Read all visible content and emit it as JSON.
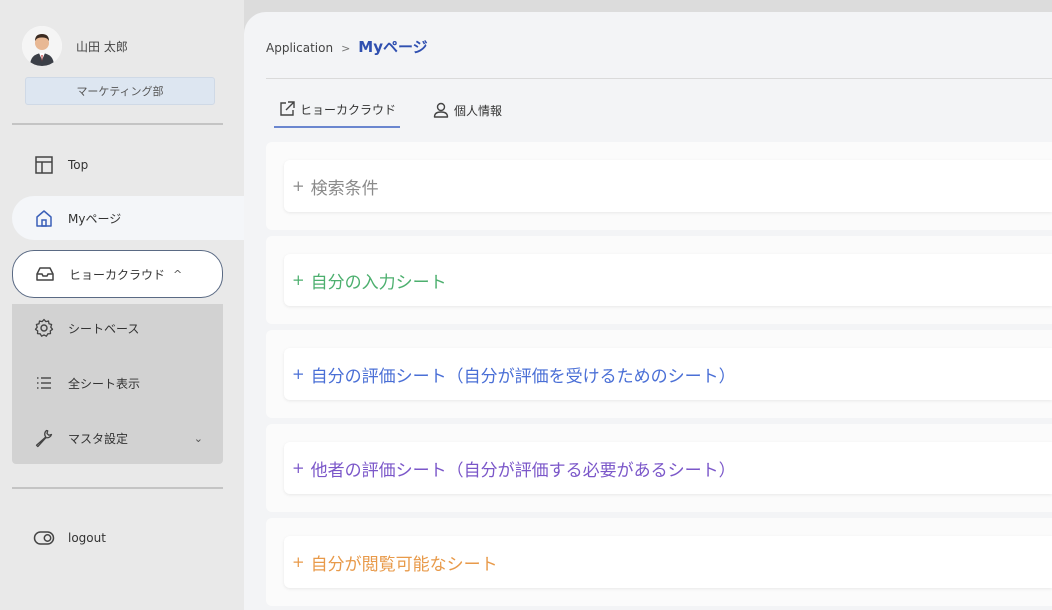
{
  "user": {
    "name": "山田 太郎",
    "department": "マーケティング部"
  },
  "sidebar": {
    "items": [
      {
        "label": "Top",
        "icon": "layout-icon"
      },
      {
        "label": "Myページ",
        "icon": "home-icon"
      },
      {
        "label": "ヒョーカクラウド",
        "icon": "inbox-icon",
        "chevron": "^"
      }
    ],
    "submenu": [
      {
        "label": "シートベース",
        "icon": "gear-icon"
      },
      {
        "label": "全シート表示",
        "icon": "list-icon"
      },
      {
        "label": "マスタ設定",
        "icon": "wrench-icon",
        "chevron": "⌄"
      }
    ],
    "logout": {
      "label": "logout",
      "icon": "toggle-icon"
    }
  },
  "breadcrumb": {
    "root": "Application",
    "separator": ">",
    "current": "Myページ"
  },
  "tabs": [
    {
      "label": "ヒョーカクラウド",
      "icon": "external-link-icon",
      "active": true
    },
    {
      "label": "個人情報",
      "icon": "user-icon",
      "active": false
    }
  ],
  "panels": [
    {
      "label": "検索条件",
      "plus": "+",
      "color": "#8a8a8a"
    },
    {
      "label": "自分の入力シート",
      "plus": "+",
      "color": "#4caf6e"
    },
    {
      "label": "自分の評価シート（自分が評価を受けるためのシート）",
      "plus": "+",
      "color": "#4a6fd6"
    },
    {
      "label": "他者の評価シート（自分が評価する必要があるシート）",
      "plus": "+",
      "color": "#7b57c9"
    },
    {
      "label": "自分が閲覧可能なシート",
      "plus": "+",
      "color": "#e89a4a"
    }
  ]
}
